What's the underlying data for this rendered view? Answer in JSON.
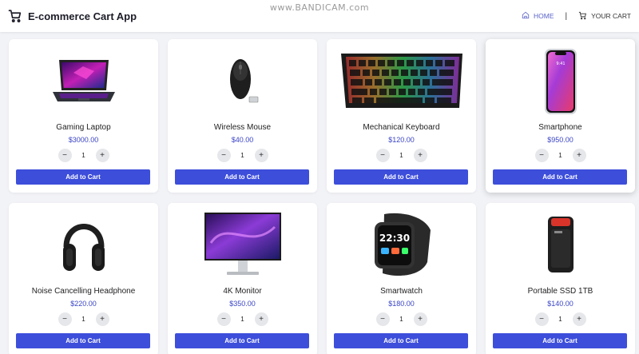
{
  "watermark": "www.BANDICAM.com",
  "header": {
    "title": "E-commerce Cart App",
    "nav_home": "HOME",
    "nav_separator": "|",
    "nav_cart": "YOUR CART"
  },
  "colors": {
    "accent": "#3d4edb",
    "price": "#3a44c6",
    "background": "#f2f3f7"
  },
  "products": [
    {
      "name": "Gaming Laptop",
      "price": "$3000.00",
      "qty": "1",
      "button": "Add to Cart",
      "icon": "laptop-image"
    },
    {
      "name": "Wireless Mouse",
      "price": "$40.00",
      "qty": "1",
      "button": "Add to Cart",
      "icon": "mouse-image"
    },
    {
      "name": "Mechanical Keyboard",
      "price": "$120.00",
      "qty": "1",
      "button": "Add to Cart",
      "icon": "keyboard-image"
    },
    {
      "name": "Smartphone",
      "price": "$950.00",
      "qty": "1",
      "button": "Add to Cart",
      "icon": "smartphone-image"
    },
    {
      "name": "Noise Cancelling Headphone",
      "price": "$220.00",
      "qty": "1",
      "button": "Add to Cart",
      "icon": "headphone-image"
    },
    {
      "name": "4K Monitor",
      "price": "$350.00",
      "qty": "1",
      "button": "Add to Cart",
      "icon": "monitor-image"
    },
    {
      "name": "Smartwatch",
      "price": "$180.00",
      "qty": "1",
      "button": "Add to Cart",
      "icon": "smartwatch-image"
    },
    {
      "name": "Portable SSD 1TB",
      "price": "$140.00",
      "qty": "1",
      "button": "Add to Cart",
      "icon": "ssd-image"
    }
  ],
  "qty_controls": {
    "minus": "−",
    "plus": "+"
  }
}
